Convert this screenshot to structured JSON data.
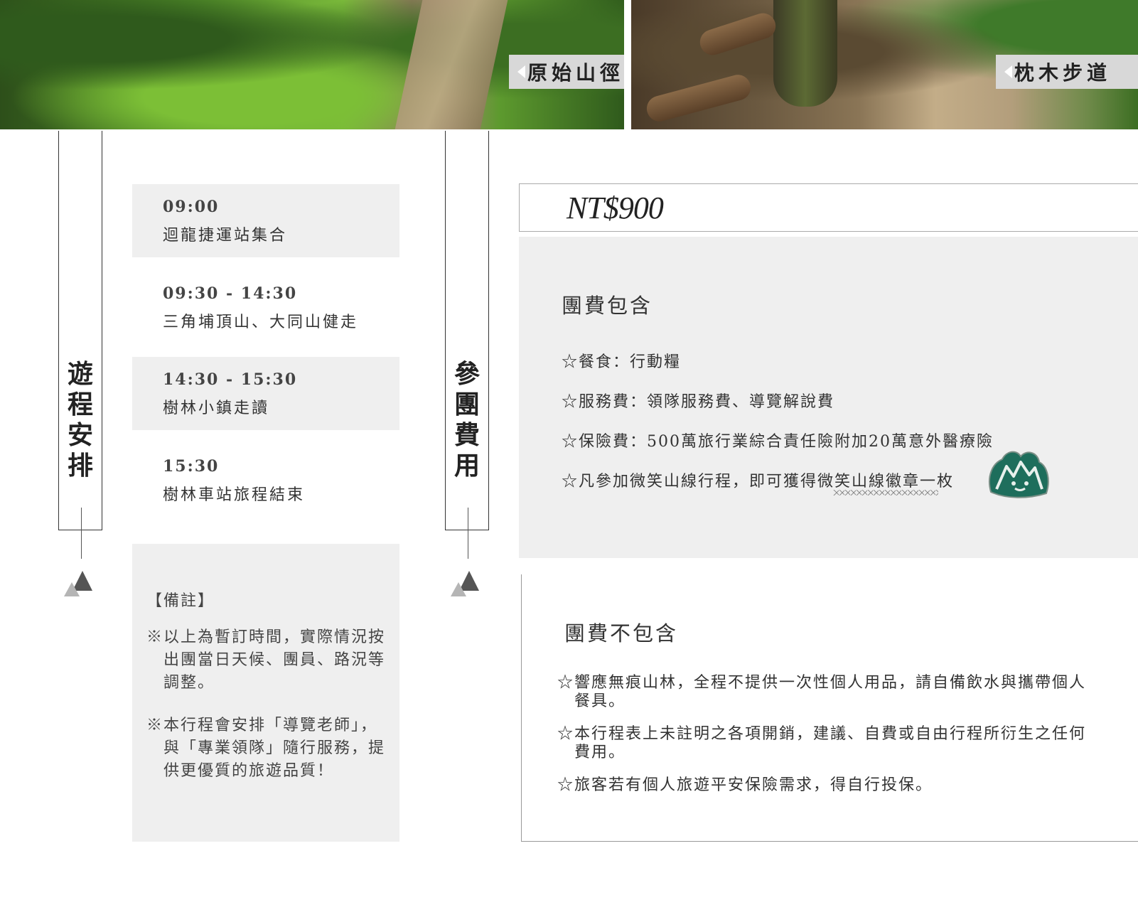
{
  "photos": {
    "left_tag": "原始山徑",
    "right_tag": "枕木步道"
  },
  "sections": {
    "itinerary_label": [
      "遊",
      "程",
      "安",
      "排"
    ],
    "fee_label": [
      "參",
      "團",
      "費",
      "用"
    ]
  },
  "schedule": [
    {
      "time": "09:00",
      "desc": "迴龍捷運站集合"
    },
    {
      "time": "09:30 - 14:30",
      "desc": "三角埔頂山、大同山健走"
    },
    {
      "time": "14:30 - 15:30",
      "desc": "樹林小鎮走讀"
    },
    {
      "time": "15:30",
      "desc": "樹林車站旅程結束"
    }
  ],
  "notes": {
    "head": "【備註】",
    "items": [
      "※以上為暫訂時間，實際情況按出團當日天候、團員、路況等調整。",
      "※本行程會安排「導覽老師」，與「專業領隊」隨行服務，提供更優質的旅遊品質！"
    ]
  },
  "price": "NT$900",
  "included": {
    "title": "團費包含",
    "items": [
      "☆餐食：行動糧",
      "☆服務費：領隊服務費、導覽解說費",
      "☆保險費：500萬旅行業綜合責任險附加20萬意外醫療險",
      "☆凡參加微笑山線行程，即可獲得微笑山線徽章一枚"
    ]
  },
  "excluded": {
    "title": "團費不包含",
    "items": [
      "☆響應無痕山林，全程不提供一次性個人用品，請自備飲水與攜帶個人餐具。",
      "☆本行程表上未註明之各項開銷，建議、自費或自由行程所衍生之任何費用。",
      "☆旅客若有個人旅遊平安保險需求，得自行投保。"
    ]
  },
  "colors": {
    "badge": "#1e6e5c",
    "panel": "#efefef"
  }
}
